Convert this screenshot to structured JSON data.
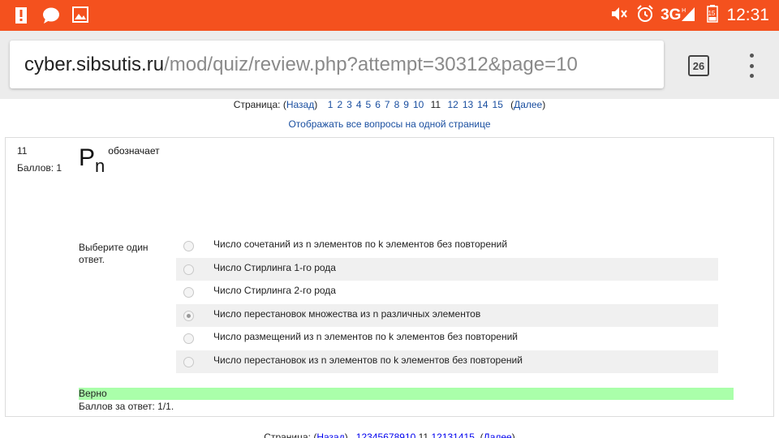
{
  "statusbar": {
    "icons_left": [
      "alert-icon",
      "chat-icon",
      "image-icon"
    ],
    "icons_right": [
      "mute-icon",
      "alarm-icon",
      "signal-icon",
      "battery-icon"
    ],
    "network": "3G",
    "battery_level": "15",
    "time": "12:31",
    "color": "#f4511e"
  },
  "browser": {
    "url_host": "cyber.sibsutis.ru",
    "url_path": "/mod/quiz/review.php?attempt=30312&page=10",
    "tab_count": "26"
  },
  "pager": {
    "label": "Страница: (",
    "prev": "Назад",
    "close_prev": ")",
    "pages_before": [
      "1",
      "2",
      "3",
      "4",
      "5",
      "6",
      "7",
      "8",
      "9",
      "10"
    ],
    "current": "11",
    "pages_after": [
      "12",
      "13",
      "14",
      "15"
    ],
    "open_next": "(",
    "next": "Далее",
    "close_next": ")"
  },
  "show_all": "Отображать все вопросы на одной странице",
  "question": {
    "number": "11",
    "points": "Баллов: 1",
    "symbol": "P",
    "subscript": "n",
    "text": "обозначает",
    "prompt": "Выберите один ответ.",
    "answers": [
      {
        "label": "Число сочетаний из n элементов по k элементов без повторений",
        "selected": false
      },
      {
        "label": "Число Стирлинга 1-го рода",
        "selected": false
      },
      {
        "label": "Число Стирлинга 2-го рода",
        "selected": false
      },
      {
        "label": "Число перестановок множества из n различных элементов",
        "selected": true
      },
      {
        "label": "Число размещений из n элементов по k элементов без повторений",
        "selected": false
      },
      {
        "label": "Число перестановок из n элементов по k элементов без повторений",
        "selected": false
      }
    ],
    "result": "Верно",
    "grade": "Баллов за ответ: 1/1."
  },
  "colors": {
    "link": "#1a4fa0",
    "correct_bg": "#aaffaa"
  }
}
